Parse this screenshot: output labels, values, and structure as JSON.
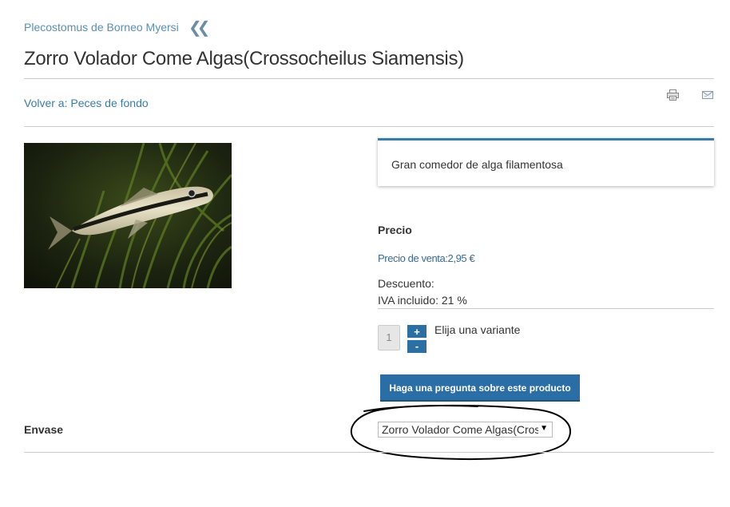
{
  "breadcrumb": {
    "label": "Plecostomus de Borneo Myersi",
    "icon": "double-chevron-left-icon"
  },
  "page": {
    "title": "Zorro Volador Come Algas(Crossocheilus Siamensis)"
  },
  "nav": {
    "back_link": "Volver a: Peces de fondo"
  },
  "toolbar": {
    "print_icon": "print-icon",
    "email_icon": "email-icon"
  },
  "product": {
    "short_description": "Gran comedor de alga filamentosa",
    "price_heading": "Precio",
    "sale_price": "Precio de venta:2,95 €",
    "discount": "Descuento:",
    "vat": "IVA incluido: 21 %",
    "quantity": "1",
    "plus_label": "+",
    "minus_label": "-",
    "variant_hint": "Elija una variante",
    "ask_button": "Haga una pregunta sobre este producto"
  },
  "variant": {
    "label": "Envase",
    "selected": "Zorro Volador Come Algas(Crossocheilus Siamensis)",
    "arrow": "▼"
  },
  "colors": {
    "accent": "#2b6ea5",
    "link": "#3a7ca8"
  }
}
